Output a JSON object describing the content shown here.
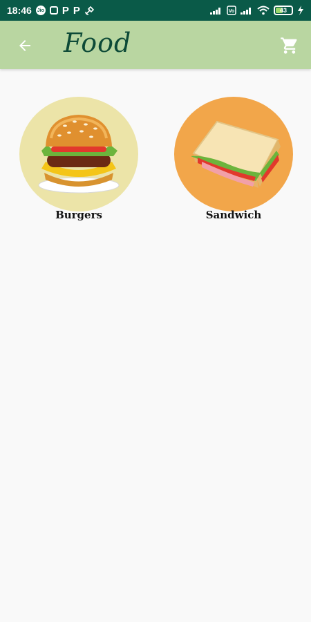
{
  "status_bar": {
    "time": "18:46",
    "battery": "43"
  },
  "app_bar": {
    "title": "Food",
    "back_icon": "arrow-back-icon",
    "cart_icon": "shopping-cart-icon"
  },
  "categories": [
    {
      "label": "Burgers",
      "image": "burger-image",
      "bg": "#ece4a8"
    },
    {
      "label": "Sandwich",
      "image": "sandwich-image",
      "bg": "#f2a64a"
    }
  ],
  "colors": {
    "status_bar": "#0a5a48",
    "app_bar": "#b9d6a1",
    "title": "#0d4a37",
    "background": "#f9f9f9"
  }
}
